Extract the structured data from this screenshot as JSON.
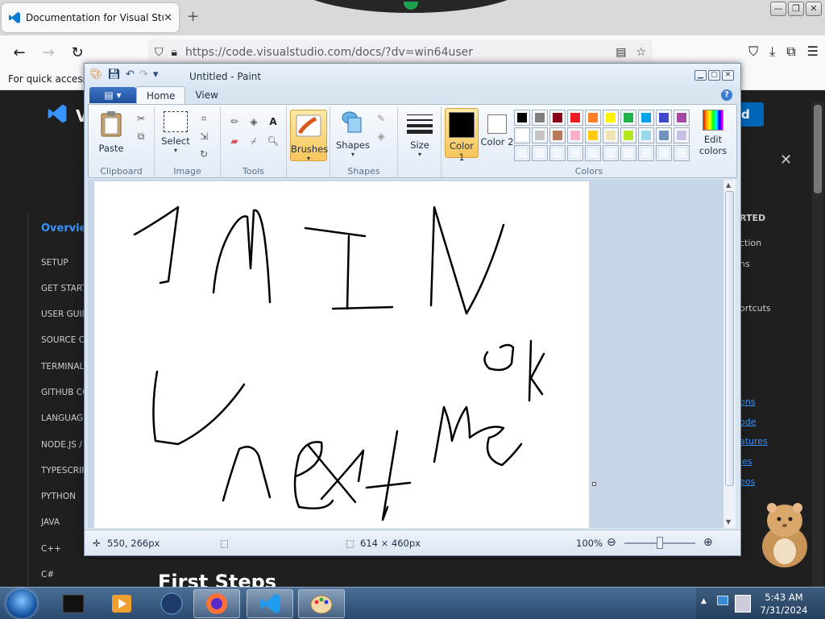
{
  "browser": {
    "tab_title": "Documentation for Visual Studio",
    "url": "https://code.visualstudio.com/docs/?dv=win64user",
    "bookmark_hint": "For quick access,"
  },
  "docs_page": {
    "overview": "Overvie",
    "nav_items": [
      "SETUP",
      "GET START",
      "USER GUID",
      "SOURCE C",
      "TERMINAL",
      "GITHUB CO",
      "LANGUAG",
      "NODE.JS /",
      "TYPESCRIP",
      "PYTHON",
      "JAVA",
      "C++",
      "C#"
    ],
    "right_items": [
      "RTED",
      "ction",
      "ns",
      "ortcuts"
    ],
    "right_links": [
      "ons",
      "ode",
      "atures",
      "ies",
      "eos"
    ],
    "download_btn": "d",
    "vs_partial": "V",
    "heading": "First Steps"
  },
  "paint": {
    "title": "Untitled - Paint",
    "tabs": [
      "Home",
      "View"
    ],
    "groups": {
      "clipboard": "Clipboard",
      "image": "Image",
      "tools": "Tools",
      "shapes": "Shapes",
      "colors": "Colors"
    },
    "buttons": {
      "paste": "Paste",
      "select": "Select",
      "brushes": "Brushes",
      "shapes": "Shapes",
      "size": "Size",
      "color1": "Color 1",
      "color2": "Color 2",
      "edit_colors": "Edit colors"
    },
    "color1": "#000000",
    "color2": "#ffffff",
    "palette": [
      "#000000",
      "#7f7f7f",
      "#880015",
      "#ed1c24",
      "#ff7f27",
      "#fff200",
      "#22b14c",
      "#00a2e8",
      "#3f48cc",
      "#a349a4",
      "#ffffff",
      "#c3c3c3",
      "#b97a57",
      "#ffaec9",
      "#ffc90e",
      "#efe4b0",
      "#b5e61d",
      "#99d9ea",
      "#7092be",
      "#c8bfe7",
      "",
      "",
      "",
      "",
      "",
      "",
      "",
      "",
      "",
      ""
    ],
    "status": {
      "cursor_pos": "550, 266px",
      "canvas_size": "614 × 460px",
      "zoom": "100%"
    }
  },
  "taskbar": {
    "time": "5:43 AM",
    "date": "7/31/2024"
  }
}
